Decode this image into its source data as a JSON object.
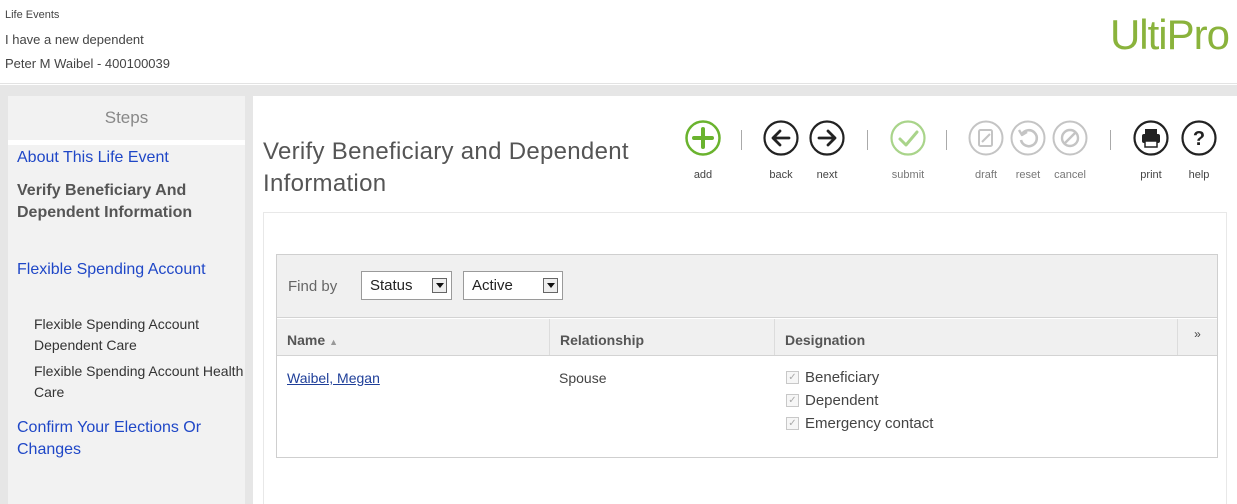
{
  "header": {
    "section": "Life Events",
    "event": "I have a new dependent",
    "employee": "Peter M Waibel - 400100039",
    "logo": "UltiPro",
    "logo_color": "#8ab33c"
  },
  "sidebar": {
    "title": "Steps",
    "steps": [
      {
        "label": "About This Life Event",
        "state": "link"
      },
      {
        "label": "Verify Beneficiary And Dependent Information",
        "state": "current"
      },
      {
        "label": "Flexible Spending Account",
        "state": "link"
      },
      {
        "label": "Flexible Spending Account Dependent Care",
        "state": "sub"
      },
      {
        "label": "Flexible Spending Account Health Care",
        "state": "sub"
      },
      {
        "label": "Confirm Your Elections Or Changes",
        "state": "link"
      }
    ]
  },
  "main": {
    "title": "Verify Beneficiary and Dependent Information",
    "toolbar": {
      "add": "add",
      "back": "back",
      "next": "next",
      "submit": "submit",
      "draft": "draft",
      "reset": "reset",
      "cancel": "cancel",
      "print": "print",
      "help": "help"
    },
    "find": {
      "label": "Find by",
      "field": "Status",
      "value": "Active"
    },
    "table": {
      "columns": [
        "Name",
        "Relationship",
        "Designation"
      ],
      "rows": [
        {
          "name": "Waibel, Megan",
          "relationship": "Spouse",
          "designations": [
            "Beneficiary",
            "Dependent",
            "Emergency contact"
          ]
        }
      ]
    }
  },
  "colors": {
    "link": "#1f47c7",
    "add_green": "#6ab32e",
    "submit_green_disabled": "#a9d48a",
    "disabled_gray": "#c4c4c4"
  }
}
